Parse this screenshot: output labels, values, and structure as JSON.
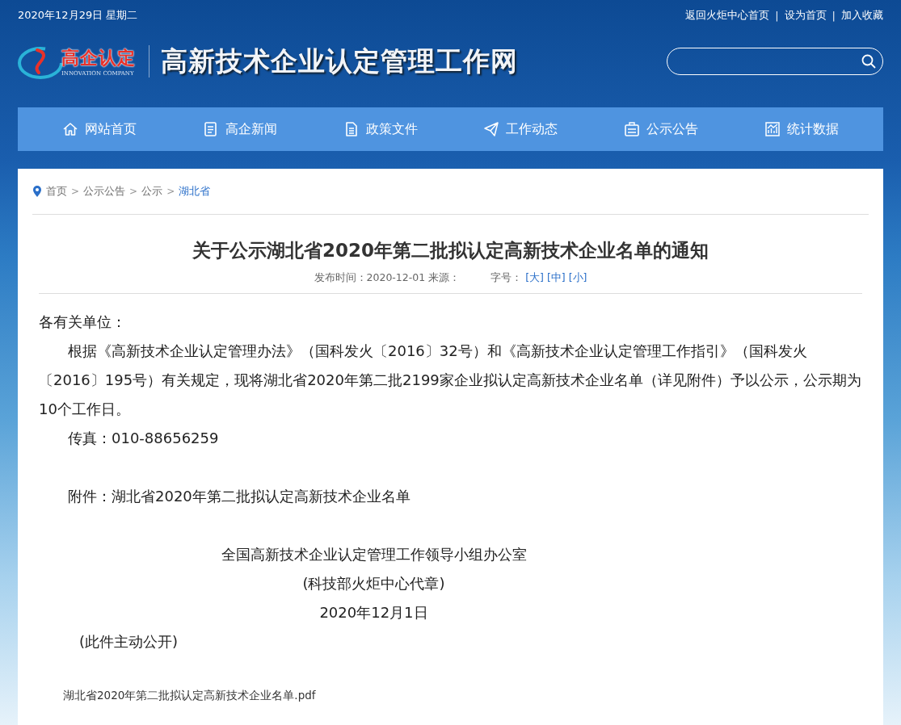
{
  "top_bar": {
    "date": "2020年12月29日 星期二",
    "links": [
      {
        "kind": "link",
        "text": "返回火炬中心首页"
      },
      {
        "kind": "separator",
        "text": "|"
      },
      {
        "kind": "link",
        "text": "设为首页"
      },
      {
        "kind": "separator",
        "text": "|"
      },
      {
        "kind": "link",
        "text": "加入收藏"
      }
    ]
  },
  "header": {
    "logo": {
      "name": "高企认定",
      "subtitle": "INNOVATION COMPANY"
    },
    "site_title": "高新技术企业认定管理工作网"
  },
  "nav": [
    {
      "label": "网站首页",
      "kind": "home"
    },
    {
      "label": "高企新闻",
      "kind": "list"
    },
    {
      "label": "政策文件",
      "kind": "file"
    },
    {
      "label": "工作动态",
      "kind": "plane"
    },
    {
      "label": "公示公告",
      "kind": "board"
    },
    {
      "label": "统计数据",
      "kind": "chart"
    }
  ],
  "breadcrumb": [
    {
      "kind": "link",
      "label": "首页",
      "current": false
    },
    {
      "kind": "separator",
      "label": ">",
      "current": false
    },
    {
      "kind": "link",
      "label": "公示公告",
      "current": false
    },
    {
      "kind": "separator",
      "label": ">",
      "current": false
    },
    {
      "kind": "link",
      "label": "公示",
      "current": false
    },
    {
      "kind": "separator",
      "label": ">",
      "current": false
    },
    {
      "kind": "link",
      "label": "湖北省",
      "current": true
    }
  ],
  "article": {
    "title": "关于公示湖北省2020年第二批拟认定高新技术企业名单的通知",
    "meta": {
      "published": "发布时间：2020-12-01",
      "source": "来源：",
      "font_size_label": "字号：",
      "font_sizes": [
        "[大]",
        "[中]",
        "[小]"
      ]
    },
    "paragraphs": [
      {
        "kind": "salutation",
        "text": "各有关单位：",
        "gap_before": false
      },
      {
        "kind": "indent",
        "text": "根据《高新技术企业认定管理办法》（国科发火〔2016〕32号）和《高新技术企业认定管理工作指引》（国科发火〔2016〕195号）有关规定，现将湖北省2020年第二批2199家企业拟认定高新技术企业名单（详见附件）予以公示，公示期为10个工作日。",
        "gap_before": false
      },
      {
        "kind": "indent",
        "text": "传真：010-88656259",
        "gap_before": false
      },
      {
        "kind": "indent",
        "text": "附件：湖北省2020年第二批拟认定高新技术企业名单",
        "gap_before": true
      },
      {
        "kind": "signature",
        "text": "全国高新技术企业认定管理工作领导小组办公室",
        "gap_before": true
      },
      {
        "kind": "signature",
        "text": "(科技部火炬中心代章)",
        "gap_before": false
      },
      {
        "kind": "signature",
        "text": "2020年12月1日",
        "gap_before": false
      },
      {
        "kind": "note",
        "text": "(此件主动公开)",
        "gap_before": false
      }
    ],
    "attachment": "湖北省2020年第二批拟认定高新技术企业名单.pdf"
  }
}
